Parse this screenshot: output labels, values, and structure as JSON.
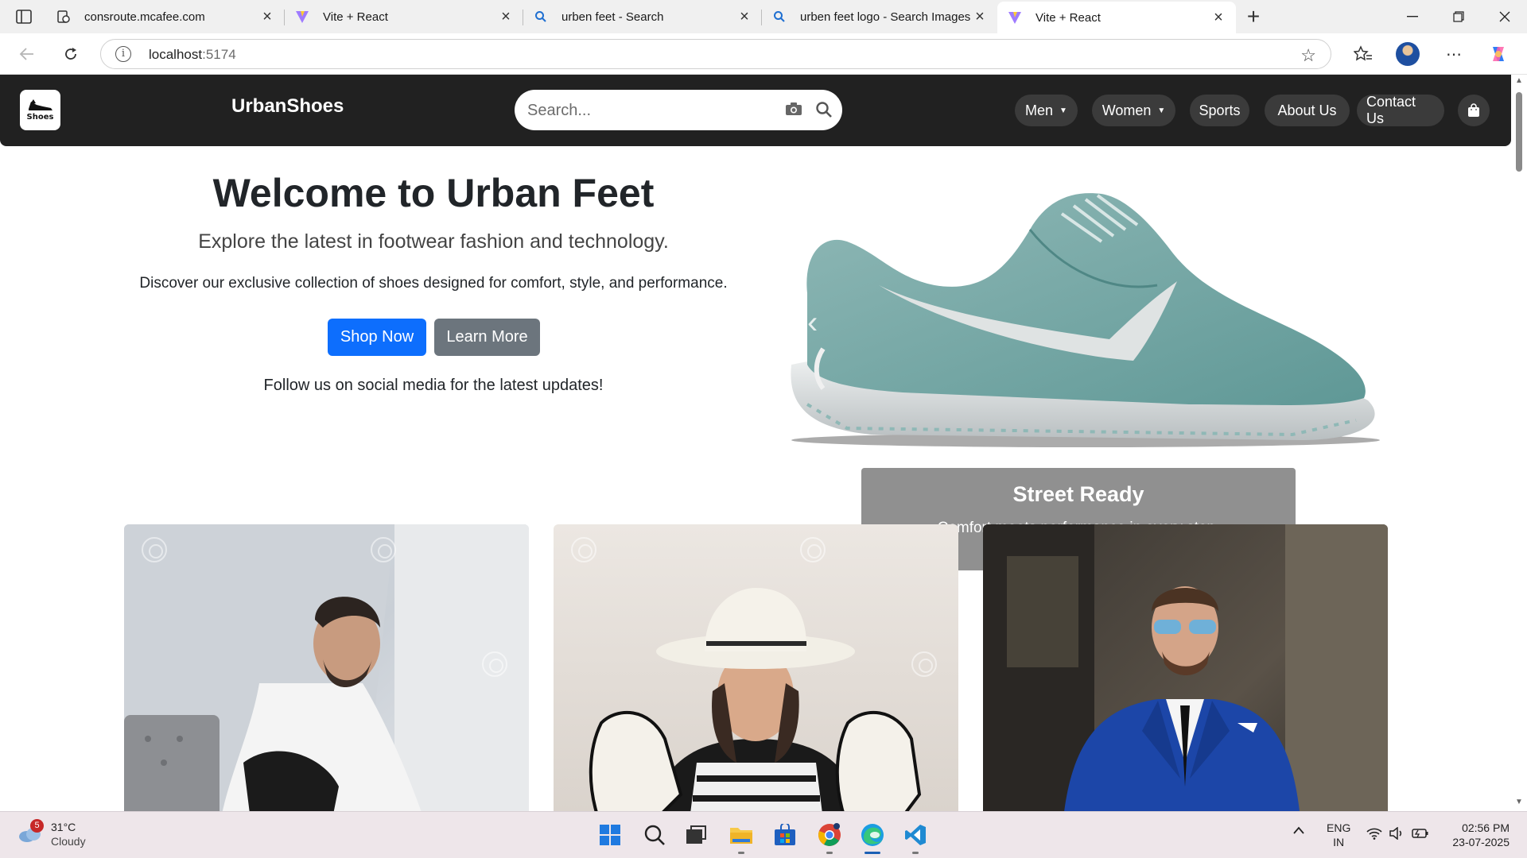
{
  "browser": {
    "tabs": [
      {
        "title": "consroute.mcafee.com",
        "icon": "mcafee-page-icon"
      },
      {
        "title": "Vite + React",
        "icon": "vite-icon"
      },
      {
        "title": "urben feet - Search",
        "icon": "search-icon"
      },
      {
        "title": "urben feet logo - Search Images",
        "icon": "search-icon"
      },
      {
        "title": "Vite + React",
        "icon": "vite-icon",
        "active": true
      }
    ],
    "url_host": "localhost",
    "url_port": ":5174"
  },
  "site": {
    "logo_text": "Shoes",
    "brand": "UrbanShoes",
    "search_placeholder": "Search...",
    "nav": [
      {
        "label": "Men",
        "dropdown": true
      },
      {
        "label": "Women",
        "dropdown": true
      },
      {
        "label": "Sports",
        "dropdown": false
      },
      {
        "label": "About Us",
        "dropdown": false
      },
      {
        "label": "Contact Us",
        "dropdown": false
      }
    ]
  },
  "hero": {
    "title": "Welcome to Urban Feet",
    "subtitle": "Explore the latest in footwear fashion and technology.",
    "description": "Discover our exclusive collection of shoes designed for comfort, style, and performance.",
    "primary_button": "Shop Now",
    "secondary_button": "Learn More",
    "follow_text": "Follow us on social media for the latest updates!"
  },
  "carousel": {
    "caption_title": "Street Ready",
    "caption_text": "Comfort meets performance in every step.",
    "active_slide": 0,
    "slide_count": 3
  },
  "cards": [
    {
      "image": "man-tying-shoes-photo"
    },
    {
      "image": "woman-with-heels-photo"
    },
    {
      "image": "man-in-blue-suit-photo"
    }
  ],
  "taskbar": {
    "weather_temp": "31°C",
    "weather_desc": "Cloudy",
    "weather_badge": "5",
    "lang_line1": "ENG",
    "lang_line2": "IN",
    "time": "02:56 PM",
    "date": "23-07-2025"
  },
  "colors": {
    "navbar_bg": "#212121",
    "pill_bg": "#3b3b3b",
    "primary": "#0d6efd",
    "secondary": "#6c757d"
  }
}
